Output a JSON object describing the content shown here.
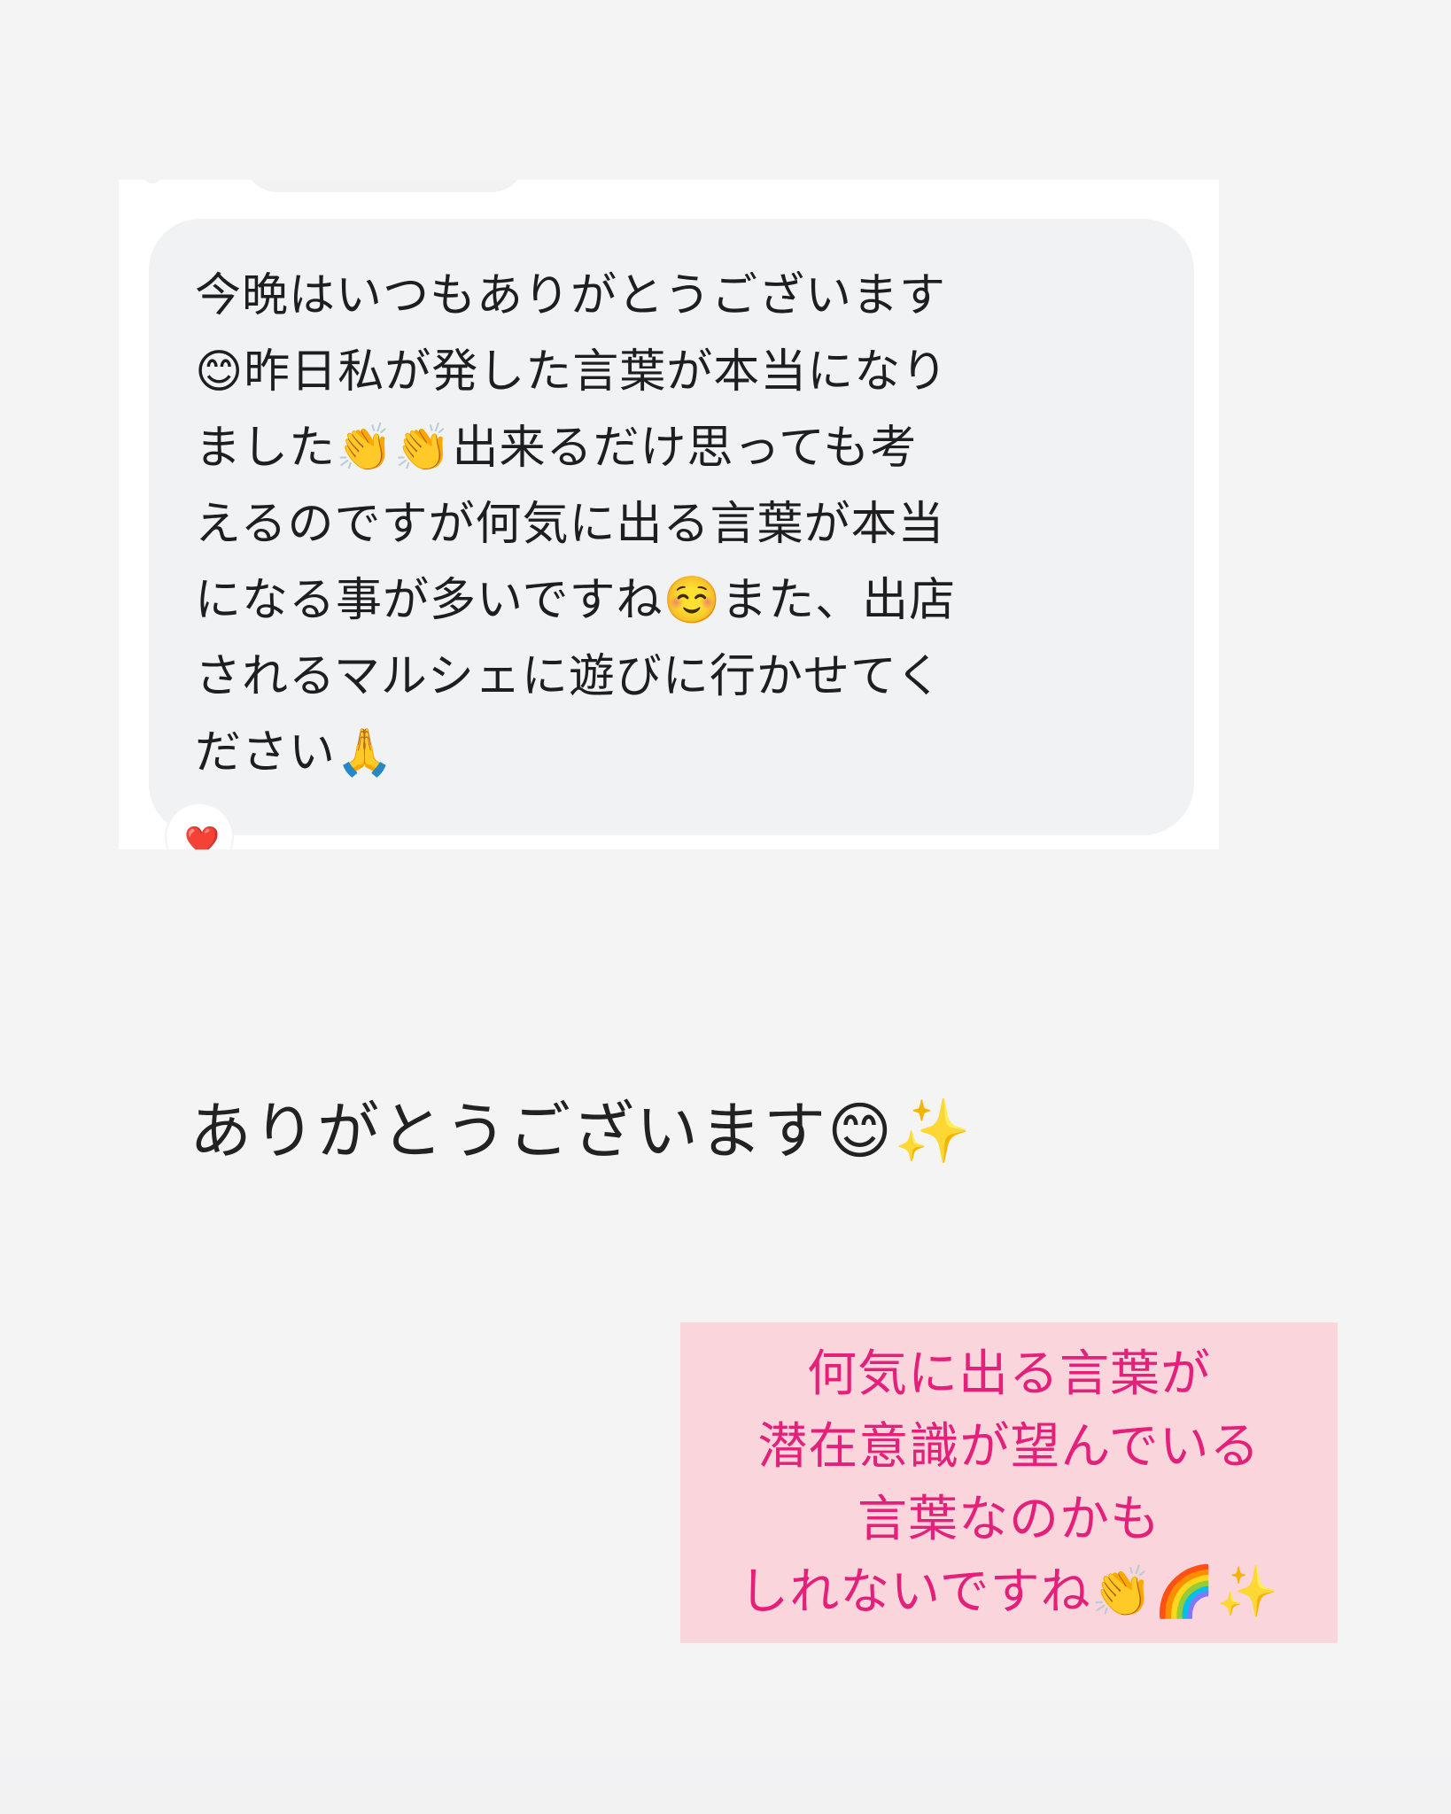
{
  "message": {
    "text": "今晩はいつもありがとうございます\n😊昨日私が発した言葉が本当になり\nました👏👏出来るだけ思っても考\nえるのですが何気に出る言葉が本当\nになる事が多いですね☺️また、出店\nされるマルシェに遊びに行かせてく\nださい🙏",
    "reaction": "❤️"
  },
  "reply": {
    "text": "ありがとうございます😊✨"
  },
  "comment": {
    "lines": [
      "何気に出る言葉が",
      "潜在意識が望んでいる",
      "言葉なのかも",
      "しれないですね👏🌈✨"
    ]
  },
  "colors": {
    "page_background": "#f4f4f5",
    "bubble_background": "#f1f2f4",
    "comment_background": "#fbd5dc",
    "comment_text": "#e4207a"
  }
}
